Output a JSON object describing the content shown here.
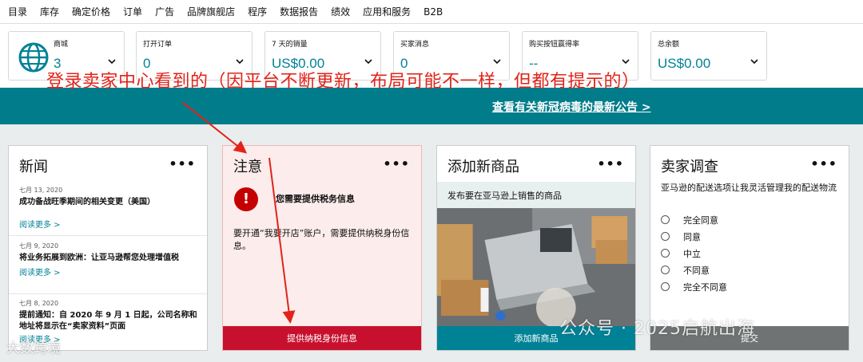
{
  "nav": {
    "items": [
      "目录",
      "库存",
      "确定价格",
      "订单",
      "广告",
      "品牌旗舰店",
      "程序",
      "数据报告",
      "绩效",
      "应用和服务",
      "B2B"
    ]
  },
  "metrics": [
    {
      "label": "商城",
      "value": "3",
      "icon": "globe-icon"
    },
    {
      "label": "打开订单",
      "value": "0"
    },
    {
      "label": "7 天的销量",
      "value": "US$0.00"
    },
    {
      "label": "买家消息",
      "value": "0"
    },
    {
      "label": "购买按钮赢得率",
      "value": "--"
    },
    {
      "label": "总余额",
      "value": "US$0.00"
    }
  ],
  "banner": {
    "link": "查看有关新冠病毒的最新公告 >"
  },
  "annotation": {
    "text": "登录卖家中心看到的（因平台不断更新，布局可能不一样，但都有提示的）",
    "color": "#e2231a"
  },
  "news": {
    "title": "新闻",
    "menu": "•••",
    "items": [
      {
        "date": "七月 13, 2020",
        "headline": "成功备战旺季期间的相关变更（美国）",
        "more": "阅读更多 >"
      },
      {
        "date": "七月 9, 2020",
        "headline": "将业务拓展到欧洲：让亚马逊帮您处理增值税",
        "more": "阅读更多 >"
      },
      {
        "date": "七月 8, 2020",
        "headline": "提前通知：自 2020 年 9 月 1 日起，公司名称和地址将显示在“卖家资料”页面",
        "more": "阅读更多 >"
      }
    ]
  },
  "notice": {
    "title": "注意",
    "menu": "•••",
    "alert_symbol": "!",
    "heading": "您需要提供税务信息",
    "body": "要开通“我要开店”账户，需要提供纳税身份信息。",
    "action": "提供纳税身份信息",
    "action_color": "#c7102e"
  },
  "add_product": {
    "title": "添加新商品",
    "menu": "•••",
    "subtitle": "发布要在亚马逊上销售的商品",
    "action": "添加新商品",
    "action_color": "#008296"
  },
  "survey": {
    "title": "卖家调查",
    "menu": "•••",
    "question": "亚马逊的配送选项让我灵活管理我的配送物流",
    "options": [
      "完全同意",
      "同意",
      "中立",
      "不同意",
      "完全不同意"
    ],
    "action": "提交",
    "action_color": "#6f7373"
  },
  "watermarks": {
    "right": "公众号 · 2025启航出海",
    "left": "大数跨境"
  },
  "colors": {
    "accent": "#008296",
    "banner": "#007c8a",
    "alert": "#c40000"
  }
}
